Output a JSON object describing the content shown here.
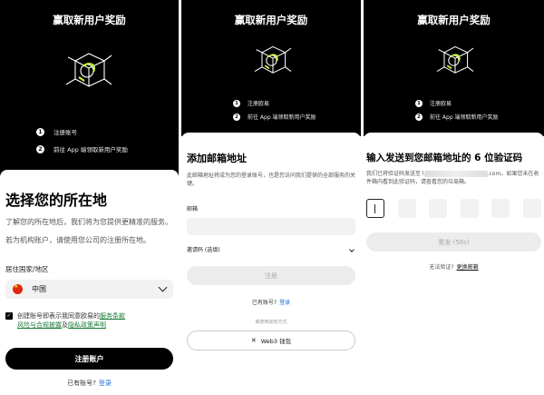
{
  "panel1": {
    "hero_title": "赢取新用户奖励",
    "steps": [
      {
        "num": "1",
        "text": "注册账号"
      },
      {
        "num": "2",
        "text": "前往 App 端领取新用户奖励"
      }
    ],
    "title": "选择您的所在地",
    "description": "了解您的所在地后，我们将为您提供更精准的服务。",
    "institution_note": "若为机构账户，请使用您公司的注册所在地。",
    "country_label": "居住国家/地区",
    "country_value": "中国",
    "agree_prefix": "创建账号即表示我同意欧易的",
    "terms_link": "服务条款",
    "risk_link": "风险与合规披露",
    "and_text": "及",
    "privacy_link": "隐私政策声明",
    "register_button": "注册账户",
    "have_account": "已有账号?",
    "login_link": "登录"
  },
  "panel2": {
    "hero_title": "赢取新用户奖励",
    "steps": [
      {
        "num": "1",
        "text": "注册欧易"
      },
      {
        "num": "2",
        "text": "前往 App 端领取新用户奖励"
      }
    ],
    "title": "添加邮箱地址",
    "description": "此邮箱地址将成为您的登录账号，也是您访问我们提供的全部服务的关键。",
    "email_label": "邮箱",
    "email_value": "",
    "referral_label": "邀请码 (选填)",
    "register_button": "注册",
    "have_account": "已有账号?",
    "login_link": "登录",
    "or_text": "或使用其他方式",
    "web3_button": "Web3 钱包"
  },
  "panel3": {
    "hero_title": "赢取新用户奖励",
    "steps": [
      {
        "num": "1",
        "text": "注册欧易"
      },
      {
        "num": "2",
        "text": "前往 App 端领取新用户奖励"
      }
    ],
    "title": "输入发送到您邮箱地址的 6 位验证码",
    "desc_prefix": "我们已将验证码发送至 ",
    "desc_domain": "l",
    "desc_domain_end": ".com。如果您未在收件箱内看到此验证码，请查看您的垃圾箱。",
    "resend_button": "重发 (58s)",
    "no_code": "无法验证?",
    "change_email_link": "更换邮箱"
  },
  "icons": [
    "shield-cube-illustration",
    "chevron-down-icon",
    "checkmark-icon",
    "web3-wallet-icon",
    "china-flag-icon"
  ],
  "colors": {
    "accent_link": "#1b7c3a",
    "login_link": "#1d6fd8",
    "hero_bg": "#000000",
    "primary_button": "#000000"
  }
}
